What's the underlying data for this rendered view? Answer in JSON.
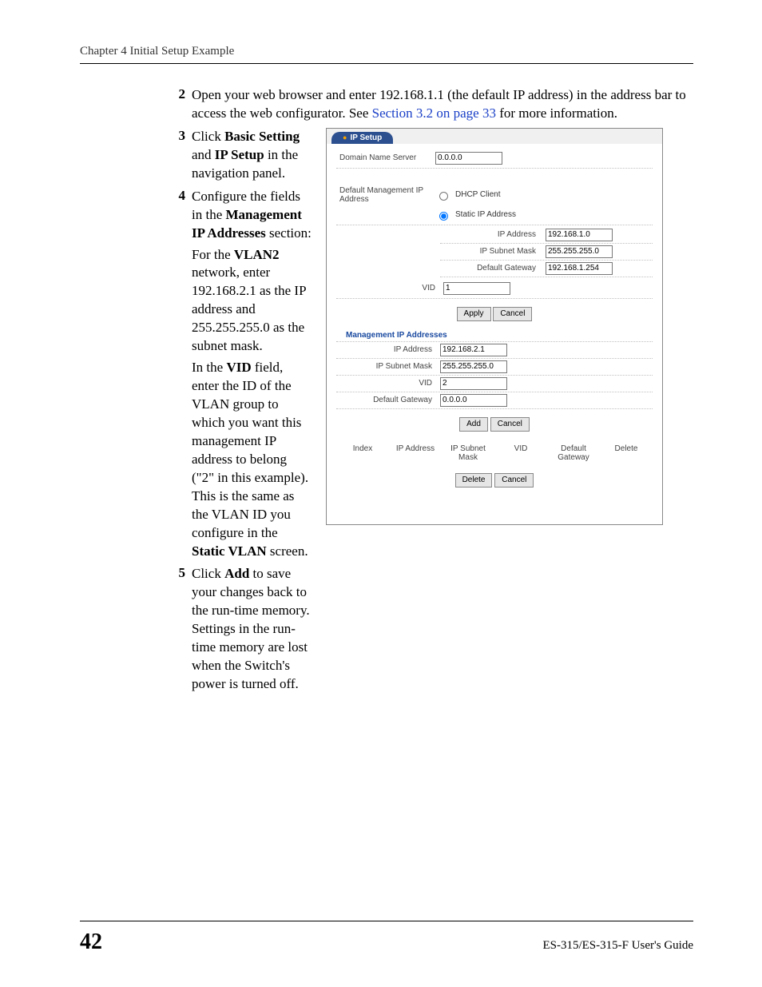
{
  "header": {
    "running": "Chapter 4 Initial Setup Example"
  },
  "steps": {
    "s2": {
      "num": "2",
      "text_a": "Open your web browser and enter 192.168.1.1 (the default IP address) in the address bar to access the web configurator. See ",
      "link": "Section 3.2 on page 33",
      "text_b": " for more information."
    },
    "s3": {
      "num": "3",
      "pre": "Click ",
      "b1": "Basic Setting",
      "mid": " and ",
      "b2": "IP Setup",
      "post": " in the navigation panel."
    },
    "s4": {
      "num": "4",
      "line1_pre": "Configure the fields in the ",
      "line1_b": "Management IP Addresses",
      "line1_post": " section:",
      "p1_pre": "For the ",
      "p1_b": "VLAN2",
      "p1_post": " network, enter 192.168.2.1 as the IP address and 255.255.255.0 as the subnet mask.",
      "p2_pre": "In the ",
      "p2_b": "VID",
      "p2_mid": " field, enter the ID of the VLAN group to which you want this management IP address to belong (\"2\" in this example).  This is the same as the VLAN ID you configure in the ",
      "p2_b2": "Static VLAN",
      "p2_post": " screen."
    },
    "s5": {
      "num": "5",
      "pre": "Click ",
      "b1": "Add",
      "post": " to save your changes back to the run-time memory. Settings in the run-time memory are lost when the Switch's power is turned off."
    }
  },
  "ui": {
    "tab": "IP Setup",
    "dns_label": "Domain Name Server",
    "dns_value": "0.0.0.0",
    "default_mgmt_label": "Default Management IP Address",
    "dhcp_label": "DHCP Client",
    "static_label": "Static IP Address",
    "static": {
      "ip_label": "IP Address",
      "ip_value": "192.168.1.0",
      "mask_label": "IP Subnet Mask",
      "mask_value": "255.255.255.0",
      "gw_label": "Default Gateway",
      "gw_value": "192.168.1.254",
      "vid_label": "VID",
      "vid_value": "1"
    },
    "apply": "Apply",
    "cancel": "Cancel",
    "mgmt_title": "Management IP Addresses",
    "mgmt": {
      "ip_label": "IP Address",
      "ip_value": "192.168.2.1",
      "mask_label": "IP Subnet Mask",
      "mask_value": "255.255.255.0",
      "vid_label": "VID",
      "vid_value": "2",
      "gw_label": "Default Gateway",
      "gw_value": "0.0.0.0"
    },
    "add": "Add",
    "table": {
      "c1": "Index",
      "c2": "IP Address",
      "c3": "IP Subnet Mask",
      "c4": "VID",
      "c5": "Default Gateway",
      "c6": "Delete"
    },
    "delete": "Delete"
  },
  "footer": {
    "page": "42",
    "guide": "ES-315/ES-315-F User's Guide"
  }
}
